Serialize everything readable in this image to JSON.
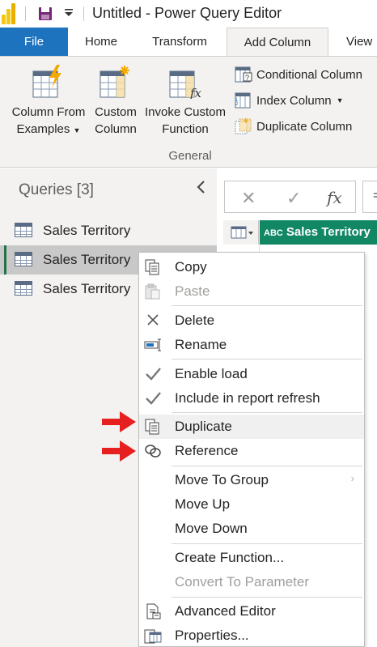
{
  "window": {
    "title": "Untitled - Power Query Editor"
  },
  "ribbon_tabs": [
    "File",
    "Home",
    "Transform",
    "Add Column",
    "View"
  ],
  "ribbon": {
    "buttons": [
      {
        "line1": "Column From",
        "line2": "Examples"
      },
      {
        "line1": "Custom",
        "line2": "Column"
      },
      {
        "line1": "Invoke Custom",
        "line2": "Function"
      }
    ],
    "small_items": [
      "Conditional Column",
      "Index Column",
      "Duplicate Column"
    ],
    "group_label": "General"
  },
  "queries": {
    "header": "Queries [3]",
    "items": [
      "Sales Territory",
      "Sales Territory",
      "Sales Territory"
    ]
  },
  "formula_bar": {
    "cancel": "✕",
    "commit": "✓",
    "fx": "fx",
    "eq": "="
  },
  "grid": {
    "column_header": "Sales Territory",
    "type_badge": "ABC"
  },
  "context_menu": {
    "items": [
      {
        "label": "Copy"
      },
      {
        "label": "Paste"
      },
      {
        "label": "Delete"
      },
      {
        "label": "Rename"
      },
      {
        "label": "Enable load"
      },
      {
        "label": "Include in report refresh"
      },
      {
        "label": "Duplicate"
      },
      {
        "label": "Reference"
      },
      {
        "label": "Move To Group"
      },
      {
        "label": "Move Up"
      },
      {
        "label": "Move Down"
      },
      {
        "label": "Create Function..."
      },
      {
        "label": "Convert To Parameter"
      },
      {
        "label": "Advanced Editor"
      },
      {
        "label": "Properties..."
      }
    ]
  },
  "colors": {
    "file_tab": "#1e73be",
    "column_header": "#128764",
    "annotation_arrow": "#e5201e"
  }
}
